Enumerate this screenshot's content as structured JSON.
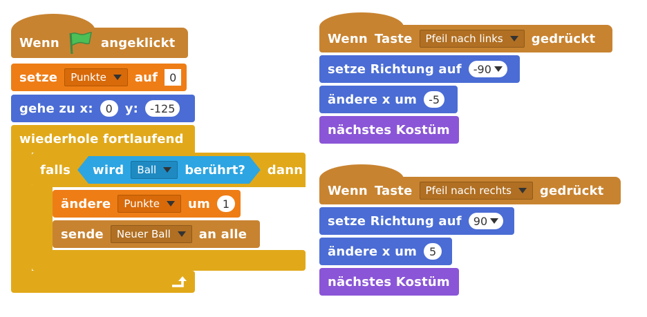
{
  "script1": {
    "when_flag": {
      "prefix": "Wenn",
      "suffix": "angeklickt"
    },
    "set_var": {
      "label": "setze",
      "variable": "Punkte",
      "to": "auf",
      "value": "0"
    },
    "goto": {
      "label": "gehe zu x:",
      "x": "0",
      "y_label": "y:",
      "y": "-125"
    },
    "forever": {
      "label": "wiederhole fortlaufend"
    },
    "if": {
      "label": "falls",
      "sensing": {
        "prefix": "wird",
        "object": "Ball",
        "suffix": "berührt?"
      },
      "then": "dann"
    },
    "change_var": {
      "label": "ändere",
      "variable": "Punkte",
      "by": "um",
      "value": "1"
    },
    "broadcast": {
      "label": "sende",
      "message": "Neuer Ball",
      "suffix": "an alle"
    }
  },
  "script2": {
    "hat": {
      "prefix": "Wenn",
      "taste": "Taste",
      "key": "Pfeil nach links",
      "suffix": "gedrückt"
    },
    "point": {
      "label": "setze Richtung auf",
      "value": "-90"
    },
    "change_x": {
      "label": "ändere x um",
      "value": "-5"
    },
    "costume": {
      "label": "nächstes Kostüm"
    }
  },
  "script3": {
    "hat": {
      "prefix": "Wenn",
      "taste": "Taste",
      "key": "Pfeil nach rechts",
      "suffix": "gedrückt"
    },
    "point": {
      "label": "setze Richtung auf",
      "value": "90"
    },
    "change_x": {
      "label": "ändere x um",
      "value": "5"
    },
    "costume": {
      "label": "nächstes Kostüm"
    }
  },
  "colors": {
    "events": "#c88330",
    "variables": "#ee7d16",
    "motion": "#4a6cd4",
    "control": "#e1a91a",
    "sensing": "#2ca5e2",
    "looks": "#8a55d7",
    "flag": "#4cbf56"
  },
  "icons": {
    "flag": "green-flag-icon",
    "loop_arrow": "loop-arrow-icon"
  }
}
